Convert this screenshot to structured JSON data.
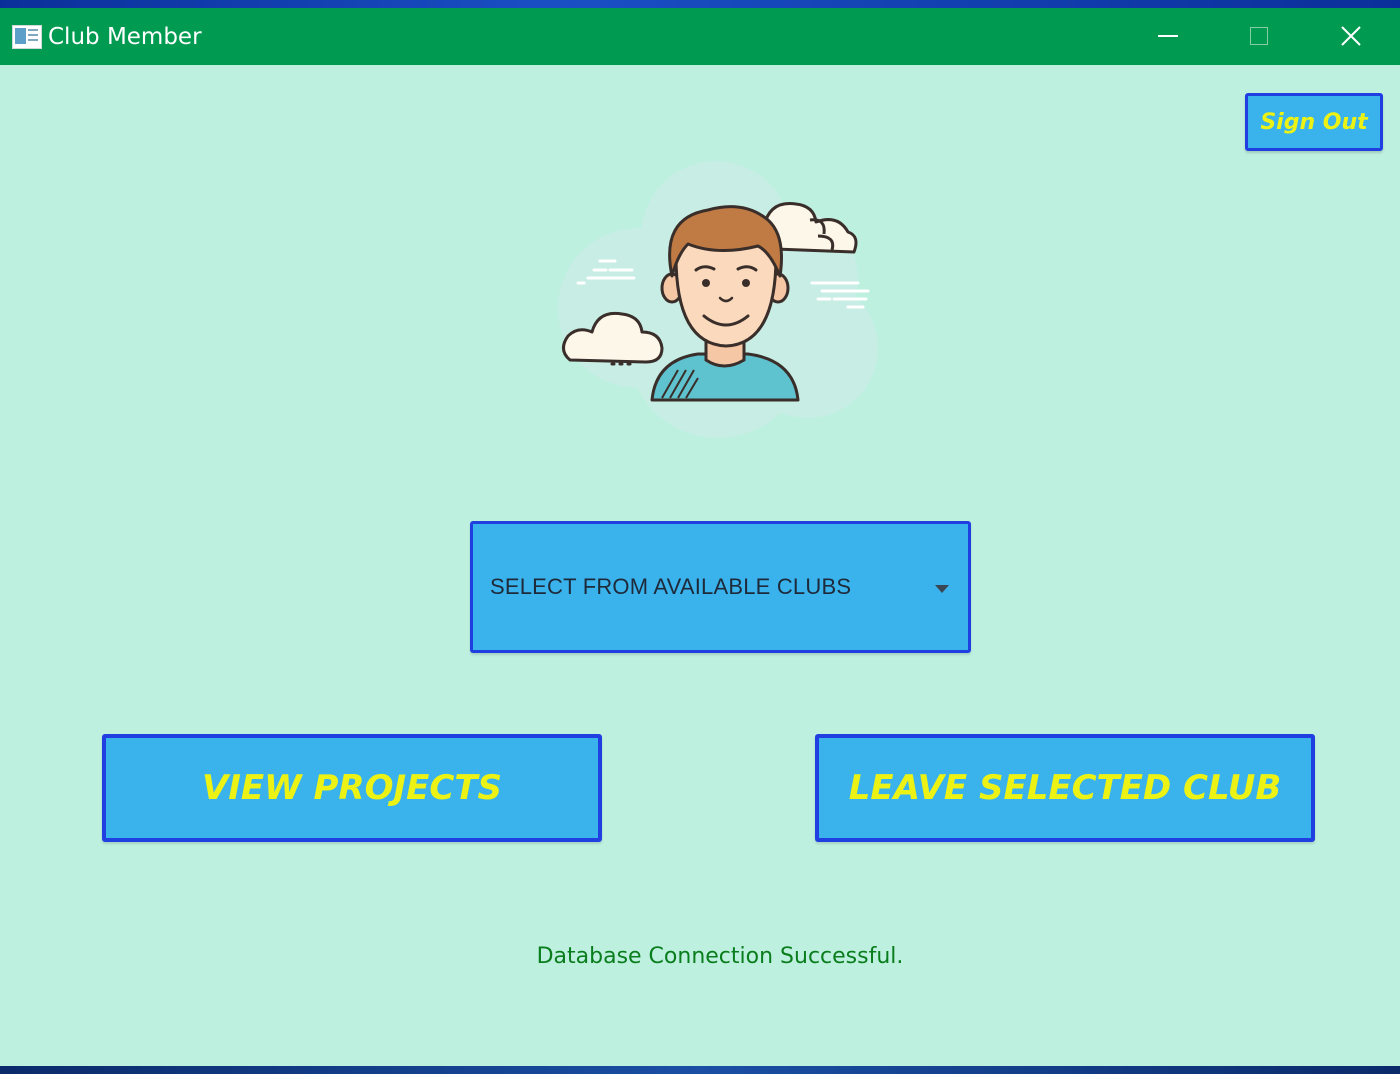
{
  "window": {
    "title": "Club Member",
    "icon": "app-window-icon",
    "controls": {
      "minimize_icon": "minimize-icon",
      "maximize_icon": "maximize-icon",
      "close_icon": "close-icon",
      "close_glyph": "✕"
    }
  },
  "header": {
    "sign_out_label": "Sign Out"
  },
  "avatar": {
    "icon": "user-avatar-illustration"
  },
  "club_select": {
    "selected_text": "SELECT FROM AVAILABLE CLUBS",
    "arrow_icon": "chevron-down-icon"
  },
  "actions": {
    "view_projects_label": "VIEW PROJECTS",
    "leave_club_label": "LEAVE SELECTED CLUB"
  },
  "status": {
    "message": "Database Connection Successful."
  },
  "colors": {
    "titlebar": "#009b50",
    "background": "#bdf0df",
    "button_fill": "#3ab3ec",
    "button_border": "#1f3fe0",
    "button_text": "#ecf214",
    "status_text": "#0a7d1d"
  }
}
